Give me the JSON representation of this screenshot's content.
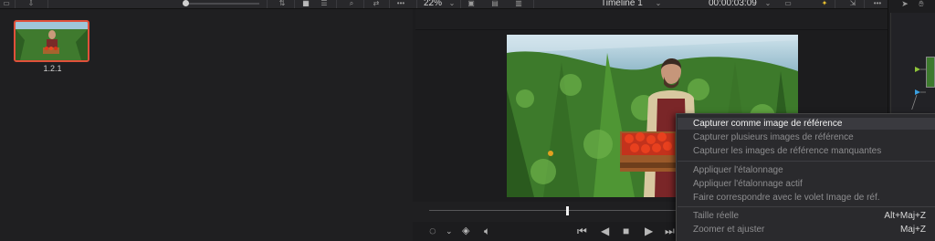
{
  "media_pool": {
    "clip": {
      "label": "1.2.1"
    }
  },
  "viewer": {
    "zoom": "22%",
    "timeline_name": "Timeline 1",
    "timecode": "00:00:03:09"
  },
  "context_menu": {
    "items": [
      {
        "label": "Capturer comme image de référence",
        "enabled": true,
        "highlighted": true
      },
      {
        "label": "Capturer plusieurs images de référence",
        "enabled": false
      },
      {
        "label": "Capturer les images de référence manquantes",
        "enabled": false
      },
      {
        "label": "Appliquer l'étalonnage",
        "enabled": false
      },
      {
        "label": "Appliquer l'étalonnage actif",
        "enabled": false
      },
      {
        "label": "Faire correspondre avec le volet Image de réf.",
        "enabled": false
      },
      {
        "label": "Taille réelle",
        "shortcut": "Alt+Maj+Z",
        "enabled": false
      },
      {
        "label": "Zoomer et ajuster",
        "shortcut": "Maj+Z",
        "enabled": false
      }
    ]
  },
  "colors": {
    "selection_border": "#e0503a",
    "menu_bg": "#2a2a2d",
    "menu_highlight": "#3a3a3f"
  }
}
